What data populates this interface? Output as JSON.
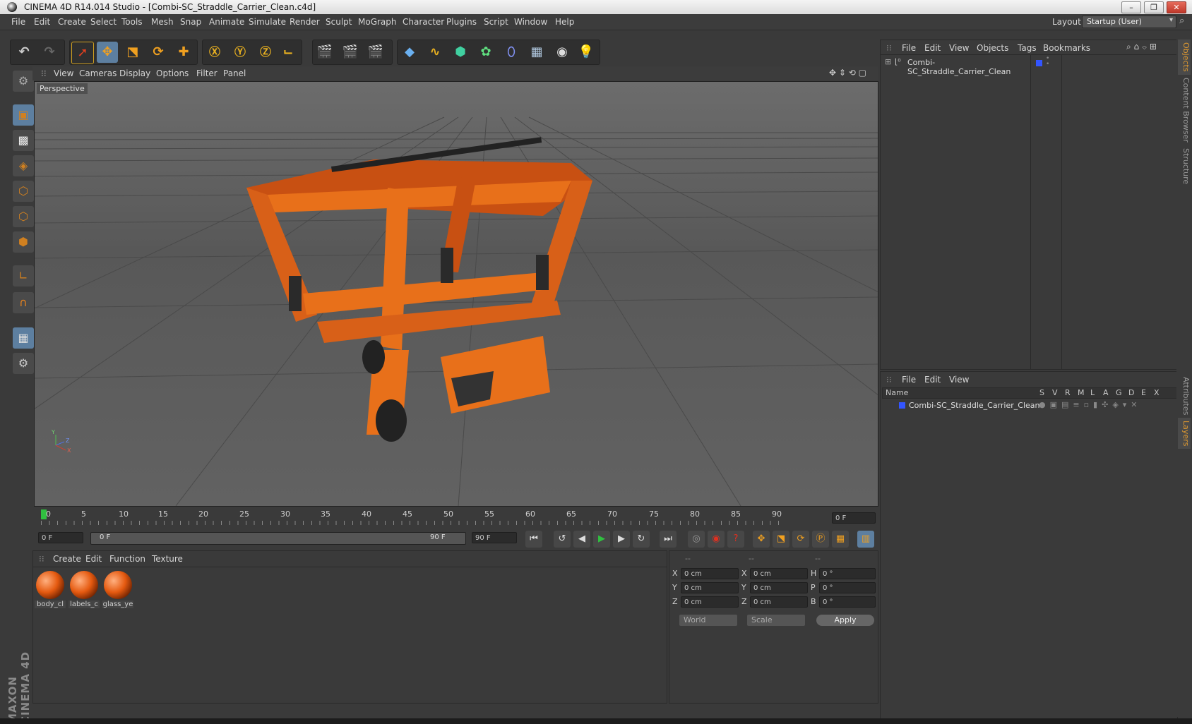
{
  "window": {
    "title": "CINEMA 4D R14.014 Studio - [Combi-SC_Straddle_Carrier_Clean.c4d]",
    "minimize": "–",
    "restore": "❐",
    "close": "✕"
  },
  "menubar": {
    "items": [
      "File",
      "Edit",
      "Create",
      "Select",
      "Tools",
      "Mesh",
      "Snap",
      "Animate",
      "Simulate",
      "Render",
      "Sculpt",
      "MoGraph",
      "Character",
      "Plugins",
      "Script",
      "Window",
      "Help"
    ],
    "layout_label": "Layout:",
    "layout_value": "Startup (User)"
  },
  "viewport": {
    "menu": [
      "View",
      "Cameras",
      "Display",
      "Options",
      "Filter",
      "Panel"
    ],
    "label": "Perspective",
    "axis_y": "Y",
    "axis_z": "Z",
    "axis_x": "X"
  },
  "timeline": {
    "ticks": [
      "0",
      "5",
      "10",
      "15",
      "20",
      "25",
      "30",
      "35",
      "40",
      "45",
      "50",
      "55",
      "60",
      "65",
      "70",
      "75",
      "80",
      "85",
      "90"
    ],
    "current_frame": "0 F",
    "start_field": "0 F",
    "range_start": "0 F",
    "range_end": "90 F",
    "end_field": "90 F"
  },
  "materials": {
    "menu": [
      "Create",
      "Edit",
      "Function",
      "Texture"
    ],
    "items": [
      "body_cl",
      "labels_c",
      "glass_ye"
    ]
  },
  "coordinates": {
    "headers": [
      "--",
      "--",
      "--"
    ],
    "rows": [
      {
        "l1": "X",
        "v1": "0 cm",
        "l2": "X",
        "v2": "0 cm",
        "l3": "H",
        "v3": "0 °"
      },
      {
        "l1": "Y",
        "v1": "0 cm",
        "l2": "Y",
        "v2": "0 cm",
        "l3": "P",
        "v3": "0 °"
      },
      {
        "l1": "Z",
        "v1": "0 cm",
        "l2": "Z",
        "v2": "0 cm",
        "l3": "B",
        "v3": "0 °"
      }
    ],
    "mode": "World",
    "transform": "Scale",
    "apply": "Apply"
  },
  "object_manager": {
    "menu": [
      "File",
      "Edit",
      "View",
      "Objects",
      "Tags",
      "Bookmarks"
    ],
    "object_name": "Combi-SC_Straddle_Carrier_Clean"
  },
  "layer_manager": {
    "menu": [
      "File",
      "Edit",
      "View"
    ],
    "name_header": "Name",
    "flag_headers": [
      "S",
      "V",
      "R",
      "M",
      "L",
      "A",
      "G",
      "D",
      "E",
      "X"
    ],
    "layer_name": "Combi-SC_Straddle_Carrier_Clean"
  },
  "right_tabs": [
    "Objects",
    "Content Browser",
    "Structure",
    "Attributes",
    "Layers"
  ],
  "branding": "MAXON CINEMA 4D",
  "colors": {
    "accent_orange": "#e8701a",
    "layer_blue": "#3355ff",
    "selected_blue": "#5d7fa0"
  }
}
